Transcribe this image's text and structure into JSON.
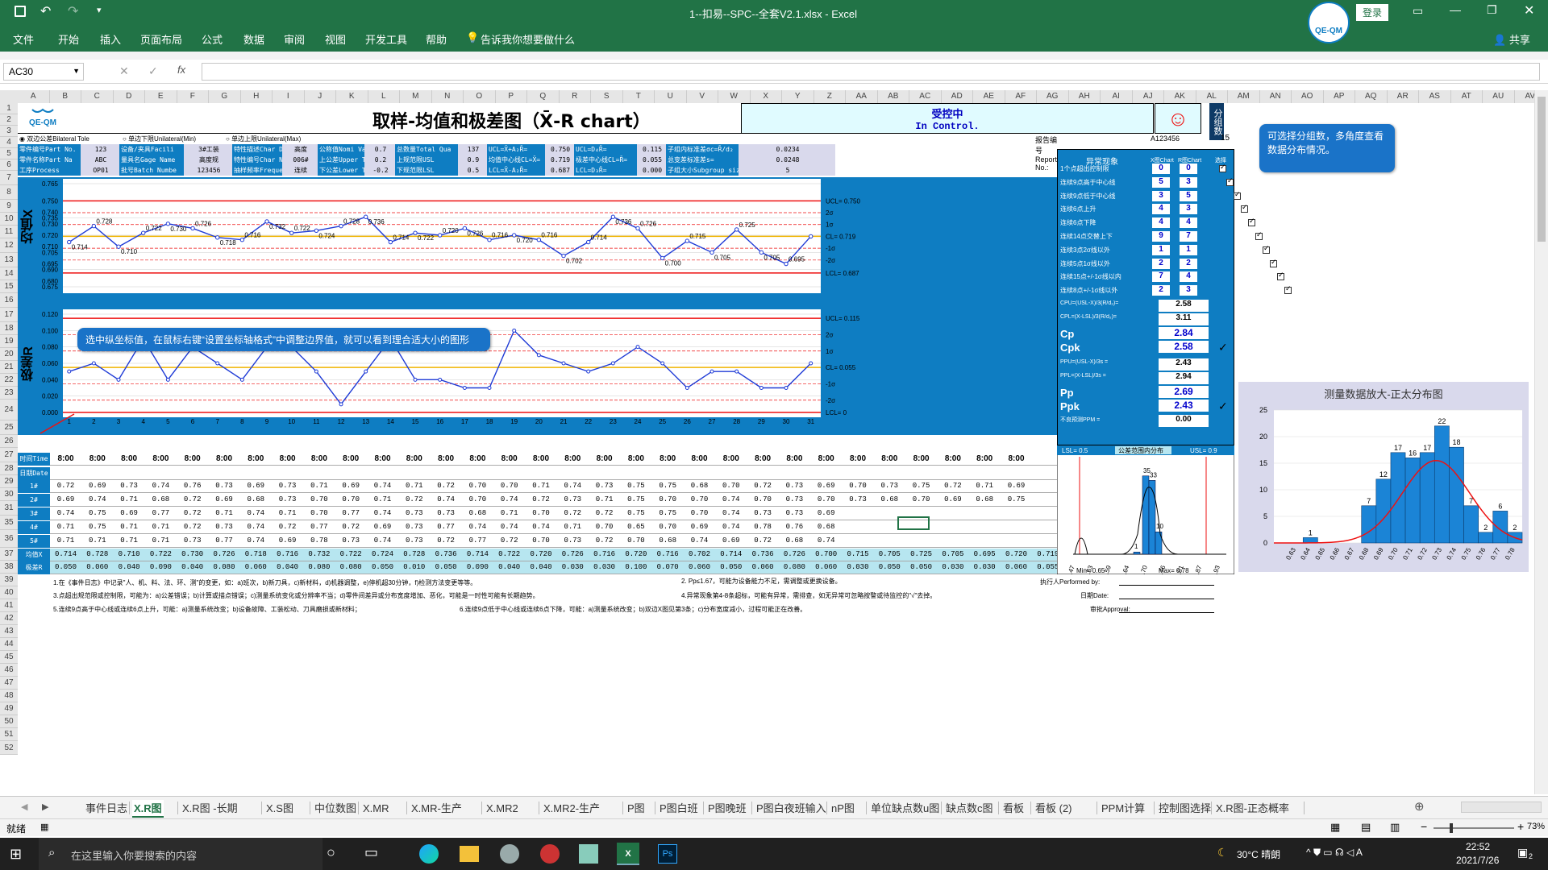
{
  "window": {
    "title": "1--扣易--SPC--全套V2.1.xlsx  -  Excel",
    "login": "登录",
    "share": "共享"
  },
  "qat": {
    "save": "save-icon",
    "undo": "undo-icon",
    "redo": "redo-icon"
  },
  "ribbon": {
    "tabs": [
      "文件",
      "开始",
      "插入",
      "页面布局",
      "公式",
      "数据",
      "审阅",
      "视图",
      "开发工具",
      "帮助"
    ],
    "tell_me": "告诉我你想要做什么"
  },
  "formula": {
    "namebox": "AC30",
    "content": ""
  },
  "columns": [
    "A",
    "B",
    "C",
    "D",
    "E",
    "F",
    "G",
    "H",
    "I",
    "J",
    "K",
    "L",
    "M",
    "N",
    "O",
    "P",
    "Q",
    "R",
    "S",
    "T",
    "U",
    "V",
    "W",
    "X",
    "Y",
    "Z",
    "AA",
    "AB",
    "AC",
    "AD",
    "AE",
    "AF",
    "AG",
    "AH",
    "AI",
    "AJ",
    "AK",
    "AL",
    "AM",
    "AN",
    "AO",
    "AP",
    "AQ",
    "AR",
    "AS",
    "AT",
    "AU",
    "AV"
  ],
  "rows": [
    "1",
    "2",
    "3",
    "4",
    "5",
    "6",
    "7",
    "8",
    "9",
    "10",
    "11",
    "12",
    "13",
    "14",
    "15",
    "16",
    "17",
    "18",
    "19",
    "20",
    "21",
    "22",
    "23",
    "24",
    "25",
    "26",
    "27",
    "28",
    "29",
    "30",
    "31",
    "35",
    "36",
    "37",
    "38",
    "39",
    "40",
    "41",
    "42",
    "43",
    "44",
    "45",
    "46",
    "47",
    "48",
    "49",
    "50",
    "51",
    "52"
  ],
  "header": {
    "logo": "QE-QM",
    "title": "取样-均值和极差图（X̄-R chart）",
    "status_cn": "受控中",
    "status_en": "In Control.",
    "group_label": "分组数",
    "group_value": "15",
    "report_label": "报告编号Report No.:",
    "report_value": "A123456",
    "radio": [
      "双边公差Bilateral Tole",
      "单边下限Unilateral(Min)",
      "单边上限Unilateral(Max)"
    ]
  },
  "info": {
    "r3": [
      "零件编号Part No.",
      "123",
      "设备/夹具Facili",
      "3#工装",
      "特性描述Char De",
      "高度",
      "公称值Nomi Valu",
      "0.7",
      "总数量Total Qua",
      "137",
      "UCL=X̄+A₂R̄=",
      "0.750",
      "UCL=D₄R̄=",
      "0.115",
      "子组内标准差σc=R̄/d₂",
      "0.0234"
    ],
    "r4": [
      "零件名称Part Na",
      "ABC",
      "量具名Gage Name",
      "高度规",
      "特性编号Char No",
      "006#",
      "上公差Upper Tol",
      "0.2",
      "上规范限USL",
      "0.9",
      "均值中心线CL=X̄=",
      "0.719",
      "极差中心线CL=R̄=",
      "0.055",
      "总变差标准差s=",
      "0.0248"
    ],
    "r5": [
      "工序Process",
      "OP01",
      "批号Batch Numbe",
      "123456",
      "抽样频率Frequen",
      "连续",
      "下公差Lower Tol",
      "-0.2",
      "下规范限LSL",
      "0.5",
      "LCL=X̄-A₂R̄=",
      "0.687",
      "LCL=D₃R̄=",
      "0.000",
      "子组大小Subgroup size",
      "5"
    ]
  },
  "xbar_chart": {
    "axis_label": "均值X",
    "ylim": [
      0.675,
      0.765
    ],
    "yticks": [
      "0.765",
      "0.750",
      "0.735",
      "0.720",
      "0.705",
      "0.690",
      "0.675"
    ],
    "yticks_minor": [
      "0.740",
      "0.730",
      "0.710",
      "0.695",
      "0.680"
    ],
    "ucl": 0.75,
    "cl": 0.719,
    "lcl": 0.687,
    "labels_right": [
      "UCL= 0.750",
      "2σ",
      "1σ",
      "CL= 0.719",
      "-1σ",
      "-2σ",
      "LCL= 0.687"
    ],
    "values": [
      0.714,
      0.728,
      0.71,
      0.722,
      0.73,
      0.726,
      0.718,
      0.716,
      0.732,
      0.722,
      0.724,
      0.728,
      0.736,
      0.714,
      0.722,
      0.72,
      0.726,
      0.716,
      0.72,
      0.716,
      0.702,
      0.714,
      0.736,
      0.726,
      0.7,
      0.715,
      0.705,
      0.725,
      0.705,
      0.695,
      0.719
    ]
  },
  "r_chart": {
    "axis_label": "极差R",
    "ylim": [
      0,
      0.12
    ],
    "yticks": [
      "0.120",
      "0.100",
      "0.080",
      "0.060",
      "0.040",
      "0.020",
      "0.000"
    ],
    "ucl": 0.115,
    "cl": 0.055,
    "lcl": 0,
    "labels_right": [
      "UCL= 0.115",
      "2σ",
      "1σ",
      "CL= 0.055",
      "-1σ",
      "-2σ",
      "LCL= 0"
    ],
    "values": [
      0.05,
      0.06,
      0.04,
      0.09,
      0.04,
      0.08,
      0.06,
      0.04,
      0.08,
      0.08,
      0.05,
      0.01,
      0.05,
      0.09,
      0.04,
      0.04,
      0.03,
      0.03,
      0.1,
      0.07,
      0.06,
      0.05,
      0.06,
      0.08,
      0.06,
      0.03,
      0.05,
      0.05,
      0.03,
      0.03,
      0.06
    ]
  },
  "x_axis": [
    "1",
    "2",
    "3",
    "4",
    "5",
    "6",
    "7",
    "8",
    "9",
    "10",
    "11",
    "12",
    "13",
    "14",
    "15",
    "16",
    "17",
    "18",
    "19",
    "20",
    "21",
    "22",
    "23",
    "24",
    "25",
    "26",
    "27",
    "28",
    "29",
    "30",
    "31"
  ],
  "callout_left": "选中纵坐标值，在鼠标右键“设置坐标轴格式”中调整边界值，就可以看到理合适大小的图形",
  "callout_right": "可选择分组数，多角度查看数据分布情况。",
  "table": {
    "time_label": "时间Time",
    "date_label": "日期Date",
    "time": "8:00",
    "row_labels": [
      "1#",
      "2#",
      "3#",
      "4#",
      "5#",
      "均值X",
      "极差R"
    ],
    "r1": [
      "0.72",
      "0.69",
      "0.73",
      "0.74",
      "0.76",
      "0.73",
      "0.69",
      "0.73",
      "0.71",
      "0.69",
      "0.74",
      "0.71",
      "0.72",
      "0.70",
      "0.70",
      "0.71",
      "0.74",
      "0.73",
      "0.75",
      "0.75",
      "0.68",
      "0.70",
      "0.72",
      "0.73",
      "0.69",
      "0.70",
      "0.73",
      "0.75",
      "0.72",
      "0.71",
      "0.69"
    ],
    "r2": [
      "0.69",
      "0.74",
      "0.71",
      "0.68",
      "0.72",
      "0.69",
      "0.68",
      "0.73",
      "0.70",
      "0.70",
      "0.71",
      "0.72",
      "0.74",
      "0.70",
      "0.74",
      "0.72",
      "0.73",
      "0.71",
      "0.75",
      "0.70",
      "0.70",
      "0.74",
      "0.70",
      "0.73",
      "0.70",
      "0.73",
      "0.68",
      "0.70",
      "0.69",
      "0.68",
      "0.75"
    ],
    "r3": [
      "0.74",
      "0.75",
      "0.69",
      "0.77",
      "0.72",
      "0.71",
      "0.74",
      "0.71",
      "0.70",
      "0.77",
      "0.74",
      "0.73",
      "0.73",
      "0.68",
      "0.71",
      "0.70",
      "0.72",
      "0.72",
      "0.75",
      "0.75",
      "0.70",
      "0.74",
      "0.73",
      "0.73",
      "0.69"
    ],
    "r4": [
      "0.71",
      "0.75",
      "0.71",
      "0.71",
      "0.72",
      "0.73",
      "0.74",
      "0.72",
      "0.77",
      "0.72",
      "0.69",
      "0.73",
      "0.77",
      "0.74",
      "0.74",
      "0.74",
      "0.71",
      "0.70",
      "0.65",
      "0.70",
      "0.69",
      "0.74",
      "0.78",
      "0.76",
      "0.68"
    ],
    "r5": [
      "0.71",
      "0.71",
      "0.71",
      "0.71",
      "0.73",
      "0.77",
      "0.74",
      "0.69",
      "0.78",
      "0.73",
      "0.74",
      "0.73",
      "0.72",
      "0.77",
      "0.72",
      "0.70",
      "0.73",
      "0.72",
      "0.70",
      "0.68",
      "0.74",
      "0.69",
      "0.72",
      "0.68",
      "0.74"
    ],
    "xbar": [
      "0.714",
      "0.728",
      "0.710",
      "0.722",
      "0.730",
      "0.726",
      "0.718",
      "0.716",
      "0.732",
      "0.722",
      "0.724",
      "0.728",
      "0.736",
      "0.714",
      "0.722",
      "0.720",
      "0.726",
      "0.716",
      "0.720",
      "0.716",
      "0.702",
      "0.714",
      "0.736",
      "0.726",
      "0.700",
      "0.715",
      "0.705",
      "0.725",
      "0.705",
      "0.695",
      "0.720",
      "0.719"
    ],
    "r": [
      "0.050",
      "0.060",
      "0.040",
      "0.090",
      "0.040",
      "0.080",
      "0.060",
      "0.040",
      "0.080",
      "0.080",
      "0.050",
      "0.010",
      "0.050",
      "0.090",
      "0.040",
      "0.040",
      "0.030",
      "0.030",
      "0.100",
      "0.070",
      "0.060",
      "0.050",
      "0.060",
      "0.080",
      "0.060",
      "0.030",
      "0.050",
      "0.050",
      "0.030",
      "0.030",
      "0.060",
      "0.055"
    ]
  },
  "abnormal": {
    "title": "异常现象",
    "col_x": "X图Chart",
    "col_r": "R图Chart",
    "col_c": "选择",
    "items": [
      {
        "label": "1个点超出控制限",
        "x": "0",
        "r": "0"
      },
      {
        "label": "连续9点高于中心线",
        "x": "5",
        "r": "3"
      },
      {
        "label": "连续9点低于中心线",
        "x": "3",
        "r": "5"
      },
      {
        "label": "连续6点上升",
        "x": "4",
        "r": "3"
      },
      {
        "label": "连续6点下降",
        "x": "4",
        "r": "4"
      },
      {
        "label": "连续14点交替上下",
        "x": "9",
        "r": "7"
      },
      {
        "label": "连续3点2σ线以外",
        "x": "1",
        "r": "1"
      },
      {
        "label": "连续5点1σ线以外",
        "x": "2",
        "r": "2"
      },
      {
        "label": "连续15点+/-1σ线以内",
        "x": "7",
        "r": "4"
      },
      {
        "label": "连续8点+/-1σ线以外",
        "x": "2",
        "r": "3"
      }
    ]
  },
  "capability": {
    "cpu_label": "CPU=(USL-X̄)/3(R̄/d₂)=",
    "cpu": "2.58",
    "cpl_label": "CPL=(X̄-LSL)/3(R̄/d₂)=",
    "cpl": "3.11",
    "cp_label": "Cp",
    "cp": "2.84",
    "cpk_label": "Cpk",
    "cpk": "2.58",
    "ppu_label": "PPU=(USL-X̄)/3s =",
    "ppu": "2.43",
    "ppl_label": "PPL=(X̄-LSL)/3s =",
    "ppl": "2.94",
    "pp_label": "Pp",
    "pp": "2.69",
    "ppk_label": "Ppk",
    "ppk": "2.43",
    "ppm_label": "不良预测PPM =",
    "ppm": "0.00"
  },
  "mini_hist": {
    "lsl": "LSL= 0.5",
    "center": "公差范围内分布",
    "usl": "USL= 0.9",
    "min": "Min= 0.65",
    "max": "Max= 0.78",
    "x": [
      "0.47",
      "0.53",
      "0.59",
      "0.64",
      "0.70",
      "0.76",
      "0.81",
      "0.87",
      "0.93"
    ],
    "bars": [
      1,
      35,
      33,
      10
    ],
    "bar_labels": [
      "1",
      "35",
      "33",
      "10"
    ]
  },
  "dist_chart": {
    "title": "测量数据放大-正太分布图",
    "ylim": [
      0,
      25
    ],
    "yticks": [
      "25",
      "20",
      "15",
      "10",
      "5",
      "0"
    ],
    "categories": [
      "0.63",
      "0.64",
      "0.65",
      "0.66",
      "0.67",
      "0.68",
      "0.69",
      "0.70",
      "0.71",
      "0.72",
      "0.73",
      "0.74",
      "0.75",
      "0.76",
      "0.77",
      "0.78"
    ],
    "values": [
      0,
      0,
      1,
      0,
      0,
      0,
      7,
      12,
      17,
      16,
      17,
      22,
      18,
      7,
      2,
      6,
      2
    ],
    "value_labels": [
      "",
      "",
      "1",
      "",
      "",
      "",
      "7",
      "12",
      "17",
      "16",
      "17",
      "22",
      "18",
      "7",
      "2",
      "6",
      "2"
    ]
  },
  "notes": {
    "n1": "1.在《事件日志》中记录\"人、机、料、法、环、测\"的变更，如：a)班次，b)新刀具，c)新材料，d)机器调整，e)停机超30分钟，f)检测方法变更等等。",
    "n2": "2. Pp≤1.67，可能为设备能力不足，需调整或更换设备。",
    "n3": "3.点超出规范限或控制限，可能为：a)公差错误；b)计算或描点错误；c)测量系统变化或分辨率不当；d)零件间差异或分布宽度增加、恶化，可能是一时性可能有长期趋势。",
    "n4": "4.异常现象第4-8条超标，可能有异常，需排查，如无异常可忽略按警或待监控的\"√\"去掉。",
    "n5": "5.连续9点高于中心线或连续6点上升，可能：a)测量系统改变；b)设备故障、工装松动、刀具磨损或新材料；",
    "n6": "6.连续9点低于中心线或连续6点下降，可能：a)测量系统改变；b)双边X图见第3条；c)分布宽度减小，过程可能正在改善。",
    "performed": "执行人Performed by:",
    "date": "日期Date:",
    "approval": "审批Approval:"
  },
  "tabs": [
    "事件日志",
    "X.R图",
    "X.R图 -长期",
    "X.S图",
    "中位数图",
    "X.MR",
    "X.MR-生产",
    "X.MR2",
    "X.MR2-生产",
    "P图",
    "P图白班",
    "P图晚班",
    "P图白夜班输入",
    "nP图",
    "单位缺点数u图",
    "缺点数c图",
    "看板",
    "看板 (2)",
    "PPM计算",
    "控制图选择",
    "X.R图-正态概率"
  ],
  "active_tab": "X.R图",
  "status": {
    "ready": "就绪",
    "zoom": "73%"
  },
  "taskbar": {
    "search": "在这里输入你要搜索的内容",
    "weather": "30°C 晴朗",
    "time": "22:52",
    "date": "2021/7/26",
    "notif": "2"
  },
  "colors": {
    "excel_green": "#217346",
    "blue": "#0e7dc2",
    "red": "#e11",
    "cl": "#f0b400",
    "line": "#1f3bd6",
    "hist": "#1b84d6"
  }
}
